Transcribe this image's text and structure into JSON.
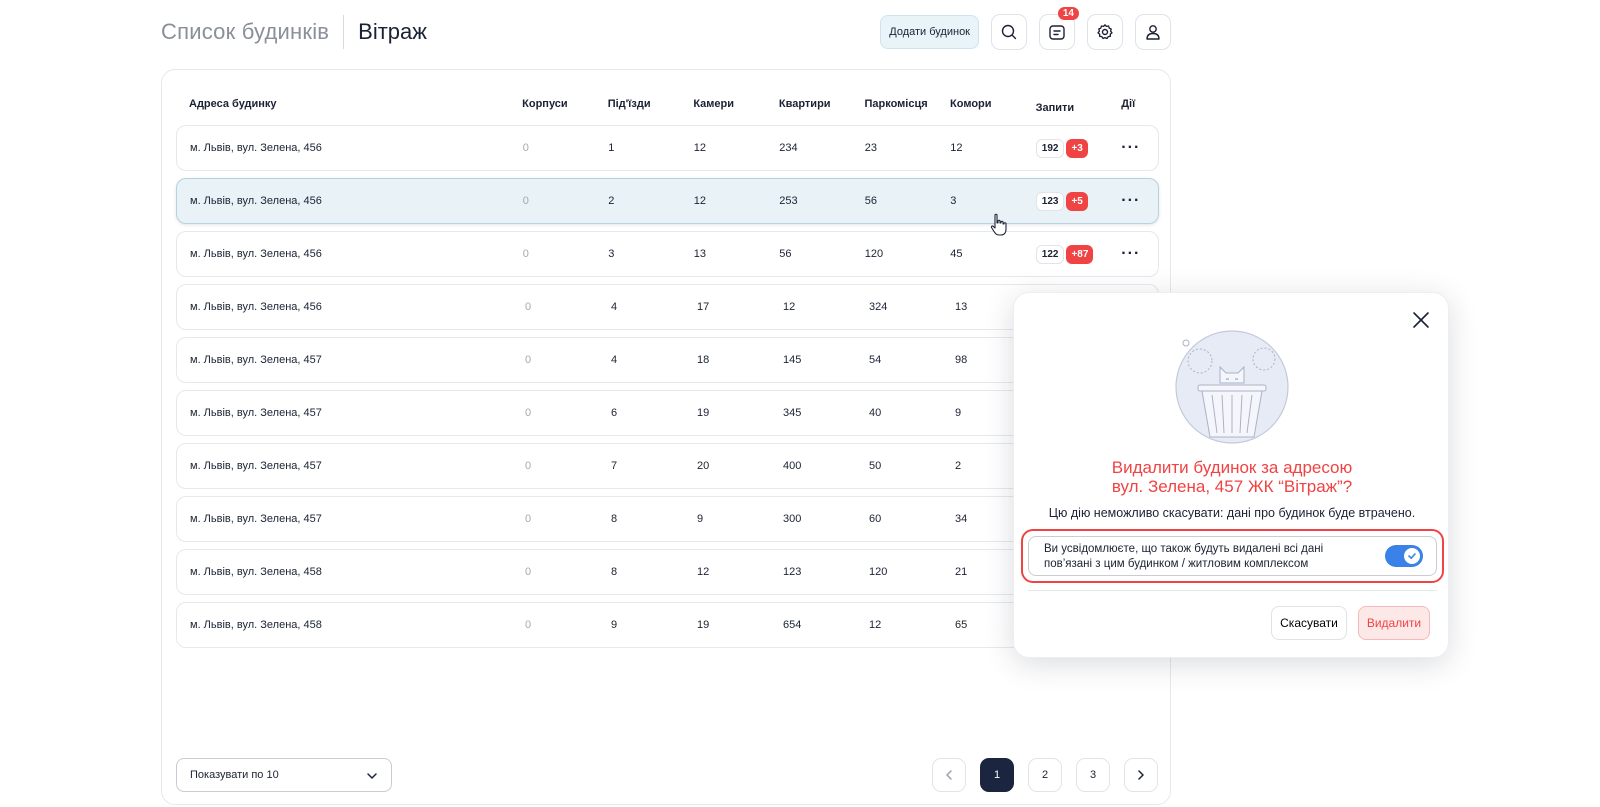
{
  "header": {
    "breadcrumb_parent": "Список будинків",
    "breadcrumb_current": "Вітраж",
    "add_button": "Додати будинок",
    "notifications_badge": "14"
  },
  "table": {
    "columns": [
      "Адреса будинку",
      "Корпуси",
      "Під'їзди",
      "Камери",
      "Квартири",
      "Паркомісця",
      "Комори",
      "Запити",
      "Дії"
    ],
    "rows": [
      {
        "address": "м. Львів, вул. Зелена, 456",
        "korpusy": "0",
        "pidizdy": "1",
        "kamery": "12",
        "kvartyry": "234",
        "parkomistsia": "23",
        "komory": "12",
        "zapyty": "192",
        "new": "+3"
      },
      {
        "address": "м. Львів, вул. Зелена, 456",
        "korpusy": "0",
        "pidizdy": "2",
        "kamery": "12",
        "kvartyry": "253",
        "parkomistsia": "56",
        "komory": "3",
        "zapyty": "123",
        "new": "+5"
      },
      {
        "address": "м. Львів, вул. Зелена, 456",
        "korpusy": "0",
        "pidizdy": "3",
        "kamery": "13",
        "kvartyry": "56",
        "parkomistsia": "120",
        "komory": "45",
        "zapyty": "122",
        "new": "+87"
      },
      {
        "address": "м. Львів, вул. Зелена, 456",
        "korpusy": "0",
        "pidizdy": "4",
        "kamery": "17",
        "kvartyry": "12",
        "parkomistsia": "324",
        "komory": "13"
      },
      {
        "address": "м. Львів, вул. Зелена, 457",
        "korpusy": "0",
        "pidizdy": "4",
        "kamery": "18",
        "kvartyry": "145",
        "parkomistsia": "54",
        "komory": "98"
      },
      {
        "address": "м. Львів, вул. Зелена, 457",
        "korpusy": "0",
        "pidizdy": "6",
        "kamery": "19",
        "kvartyry": "345",
        "parkomistsia": "40",
        "komory": "9"
      },
      {
        "address": "м. Львів, вул. Зелена, 457",
        "korpusy": "0",
        "pidizdy": "7",
        "kamery": "20",
        "kvartyry": "400",
        "parkomistsia": "50",
        "komory": "2"
      },
      {
        "address": "м. Львів, вул. Зелена, 457",
        "korpusy": "0",
        "pidizdy": "8",
        "kamery": "9",
        "kvartyry": "300",
        "parkomistsia": "60",
        "komory": "34"
      },
      {
        "address": "м. Львів, вул. Зелена, 458",
        "korpusy": "0",
        "pidizdy": "8",
        "kamery": "12",
        "kvartyry": "123",
        "parkomistsia": "120",
        "komory": "21"
      },
      {
        "address": "м. Львів, вул. Зелена, 458",
        "korpusy": "0",
        "pidizdy": "9",
        "kamery": "19",
        "kvartyry": "654",
        "parkomistsia": "12",
        "komory": "65"
      }
    ]
  },
  "footer": {
    "per_page": "Показувати по 10",
    "pages": [
      "1",
      "2",
      "3"
    ],
    "current_page": "1"
  },
  "modal": {
    "title_line1": "Видалити будинок за адресою",
    "title_line2": "вул. Зелена, 457  ЖК “Вітраж”?",
    "subtitle": "Цю дію неможливо скасувати: дані про будинок буде втрачено.",
    "confirm_text": "Ви усвідомлюєте, що також будуть видалені всі дані пов’язані з цим будинком / житловим комплексом",
    "confirm_checked": true,
    "cancel_label": "Скасувати",
    "delete_label": "Видалити"
  },
  "colors": {
    "accent_red": "#f04343",
    "toggle_blue": "#3b82e8",
    "dark_navy": "#1b2540",
    "active_row": "#e8f2f7"
  }
}
